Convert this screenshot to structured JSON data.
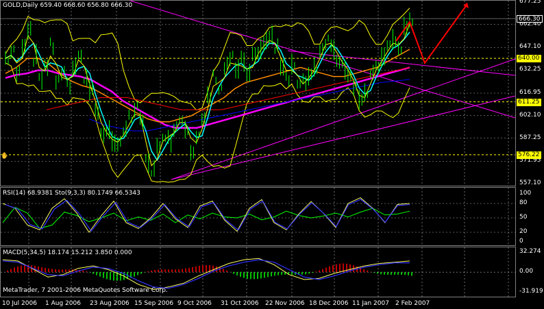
{
  "colors": {
    "background": "#000000",
    "grid": "#ffffff",
    "price": "#00ff00",
    "bollinger": "#ffff00",
    "ma_fast": "#00ffff",
    "ma_orange": "#ff8c00",
    "ma_red": "#ff0000",
    "ma_magenta": "#ff00ff",
    "ma_blue": "#0000ff",
    "trendline": "#ff00ff",
    "forecast": "#ff0000",
    "level_line": "#ffff00",
    "macd_positive": "#ff0000",
    "macd_negative": "#00ff00"
  },
  "main_panel": {
    "title": "GOLD,Daily",
    "ohlc": "659.40 668.60 656.80 666.30",
    "price_labels": [
      "677.25",
      "666.30",
      "662.40",
      "647.10",
      "640.00",
      "632.25",
      "616.95",
      "611.25",
      "602.10",
      "587.25",
      "576.22",
      "571.95",
      "557.10"
    ],
    "current_price": "666.30",
    "level_labels": [
      {
        "value": "640.00",
        "bg": "#ffff00",
        "fg": "#000000"
      },
      {
        "value": "611.25",
        "bg": "#ffff00",
        "fg": "#000000"
      },
      {
        "value": "576.22",
        "bg": "#ffff00",
        "fg": "#000000"
      }
    ],
    "hand_marker": "✋"
  },
  "rsi_panel": {
    "title": "RSI(14) 68.9381  Sto(9,3,3) 80.1749 66.5343",
    "axis_labels": [
      "100",
      "80",
      "50",
      "20",
      "0"
    ]
  },
  "macd_panel": {
    "title": "MACD(5,34,5) 18.174 15.212 3.850 0.000",
    "axis_labels": [
      "32.274",
      "0.00",
      "-31.919"
    ],
    "copyright": "MetaTrader, 7 2001-2006 MetaQuotes Software Corp."
  },
  "time_axis": [
    "10 Jul 2006",
    "1 Aug 2006",
    "23 Aug 2006",
    "15 Sep 2006",
    "9 Oct 2006",
    "31 Oct 2006",
    "22 Nov 2006",
    "18 Dec 2006",
    "11 Jan 2007",
    "2 Feb 2007"
  ],
  "chart_data": [
    {
      "type": "line",
      "title": "GOLD,Daily",
      "ylim": [
        557.1,
        677.25
      ],
      "x": [
        "10 Jul 2006",
        "1 Aug 2006",
        "23 Aug 2006",
        "15 Sep 2006",
        "9 Oct 2006",
        "31 Oct 2006",
        "22 Nov 2006",
        "18 Dec 2006",
        "11 Jan 2007",
        "2 Feb 2007"
      ],
      "series": [
        {
          "values": [
            640,
            644,
            630,
            650,
            660,
            640,
            628,
            635,
            648,
            625,
            630,
            622,
            634,
            644,
            626,
            620,
            604,
            592,
            590,
            583,
            586,
            592,
            600,
            606,
            598,
            572,
            566,
            580,
            590,
            586,
            595,
            600,
            595,
            580,
            588,
            598,
            615,
            628,
            620,
            634,
            640,
            632,
            638,
            628,
            640,
            646,
            650,
            654,
            646,
            636,
            628,
            636,
            622,
            624,
            630,
            634,
            646,
            652,
            648,
            640,
            635,
            630,
            621,
            610,
            618,
            628,
            636,
            640,
            648,
            652,
            646,
            660,
            666
          ]
        },
        {
          "values": [
            627,
            629,
            630,
            632,
            632,
            630,
            629,
            628,
            626,
            622,
            618,
            612,
            608,
            604,
            600,
            596,
            594,
            594,
            594,
            596,
            598,
            600,
            602,
            604,
            606,
            608,
            610,
            612,
            614,
            616,
            618,
            620,
            622,
            624,
            626,
            628,
            630,
            632,
            634
          ]
        },
        {
          "values": [
            630,
            634,
            640,
            640,
            636,
            630,
            625,
            622,
            620,
            616,
            612,
            608,
            604,
            600,
            598,
            598,
            600,
            602,
            606,
            610,
            614,
            620,
            624,
            626,
            628,
            630,
            632,
            634,
            632,
            630,
            628,
            628,
            630,
            632,
            634,
            638,
            642,
            646
          ]
        },
        {
          "values": [
            606,
            608,
            610,
            612,
            614,
            614,
            614,
            612,
            610,
            608,
            606,
            606,
            606,
            606,
            608,
            610,
            612,
            614,
            616,
            618,
            620,
            622,
            624,
            626,
            628,
            630,
            632,
            634
          ]
        }
      ]
    },
    {
      "type": "line",
      "title": "RSI(14) 68.9381  Sto(9,3,3) 80.1749 66.5343",
      "ylim": [
        0,
        100
      ],
      "series": [
        {
          "values": [
            40,
            72,
            60,
            28,
            35,
            62,
            55,
            42,
            50,
            60,
            44,
            52,
            45,
            58,
            40,
            56,
            48,
            60,
            52,
            50,
            58,
            46,
            52,
            64,
            55,
            50,
            54,
            60,
            52,
            62,
            70,
            56,
            58,
            64
          ]
        },
        {
          "values": [
            80,
            70,
            35,
            25,
            70,
            90,
            60,
            20,
            55,
            85,
            40,
            28,
            50,
            80,
            48,
            30,
            75,
            85,
            45,
            22,
            70,
            88,
            40,
            25,
            58,
            84,
            60,
            30,
            80,
            92,
            70,
            40,
            78,
            80
          ]
        }
      ]
    },
    {
      "type": "line",
      "title": "MACD(5,34,5) 18.174 15.212 3.850 0.000",
      "ylim": [
        -31.919,
        32.274
      ],
      "series": [
        {
          "values": [
            20,
            18,
            5,
            -8,
            -4,
            6,
            10,
            4,
            -6,
            -20,
            -28,
            -24,
            -18,
            -6,
            4,
            14,
            20,
            22,
            12,
            -4,
            -12,
            -10,
            -2,
            4,
            10,
            14,
            16,
            18
          ]
        },
        {
          "values": [
            18,
            16,
            6,
            -4,
            -6,
            2,
            8,
            6,
            -2,
            -14,
            -24,
            -26,
            -20,
            -10,
            2,
            10,
            16,
            20,
            16,
            4,
            -8,
            -12,
            -6,
            2,
            8,
            12,
            15,
            15
          ]
        }
      ]
    }
  ]
}
